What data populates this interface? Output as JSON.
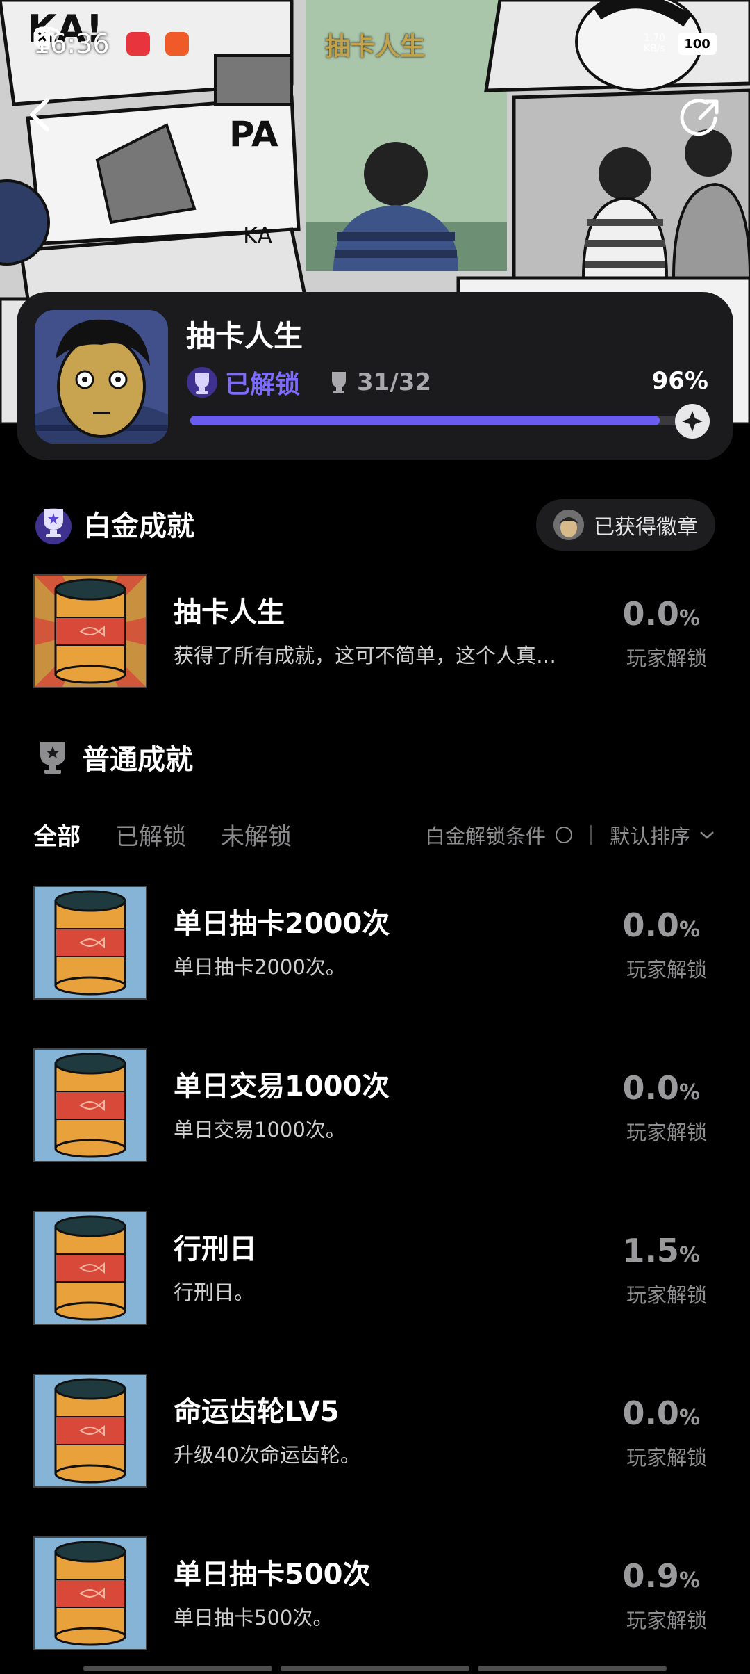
{
  "status_bar": {
    "time": "16:36",
    "app_title": "抽卡人生",
    "net_speed_value": "1.70",
    "net_speed_unit": "KB/s",
    "battery": "100"
  },
  "game": {
    "title": "抽卡人生",
    "unlocked_label": "已解锁",
    "trophy_count": "31/32",
    "percent": "96%",
    "progress": 0.96
  },
  "platinum": {
    "heading": "白金成就",
    "badge_button": "已获得徽章",
    "item": {
      "title": "抽卡人生",
      "desc": "获得了所有成就，这可不简单，这个人真…",
      "pct": "0.0",
      "unit": "%",
      "sub": "玩家解锁"
    }
  },
  "normal": {
    "heading": "普通成就",
    "tabs": [
      "全部",
      "已解锁",
      "未解锁"
    ],
    "filter_condition": "白金解锁条件",
    "sort_label": "默认排序"
  },
  "achievements": [
    {
      "title": "单日抽卡2000次",
      "desc": "单日抽卡2000次。",
      "pct": "0.0",
      "unit": "%",
      "sub": "玩家解锁"
    },
    {
      "title": "单日交易1000次",
      "desc": "单日交易1000次。",
      "pct": "0.0",
      "unit": "%",
      "sub": "玩家解锁"
    },
    {
      "title": "行刑日",
      "desc": "行刑日。",
      "pct": "1.5",
      "unit": "%",
      "sub": "玩家解锁"
    },
    {
      "title": "命运齿轮LV5",
      "desc": "升级40次命运齿轮。",
      "pct": "0.0",
      "unit": "%",
      "sub": "玩家解锁"
    },
    {
      "title": "单日抽卡500次",
      "desc": "单日抽卡500次。",
      "pct": "0.9",
      "unit": "%",
      "sub": "玩家解锁"
    }
  ],
  "colors": {
    "accent": "#6b5cf0",
    "can_orange": "#e9a23b",
    "can_red": "#d9493a",
    "can_lid": "#1f3a3f",
    "icon_bg_blue": "#86b4d6"
  },
  "icons": {
    "back": "chevron-left-icon",
    "share": "share-icon",
    "trophy": "trophy-icon",
    "compass": "compass-icon"
  }
}
